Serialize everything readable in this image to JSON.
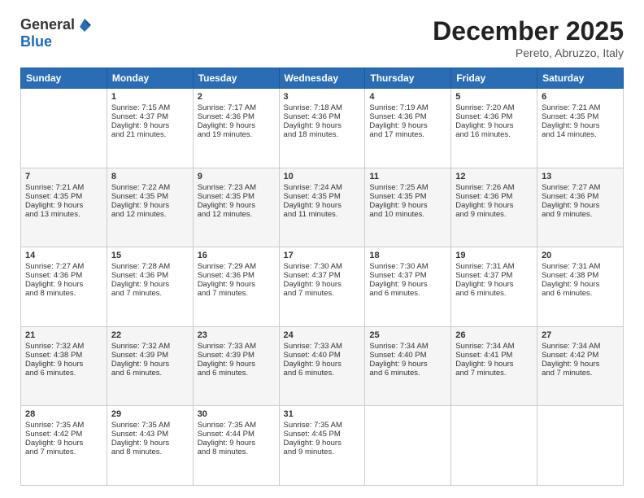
{
  "header": {
    "logo_general": "General",
    "logo_blue": "Blue",
    "month_title": "December 2025",
    "location": "Pereto, Abruzzo, Italy"
  },
  "days_of_week": [
    "Sunday",
    "Monday",
    "Tuesday",
    "Wednesday",
    "Thursday",
    "Friday",
    "Saturday"
  ],
  "weeks": [
    [
      {
        "day": "",
        "info": ""
      },
      {
        "day": "1",
        "info": "Sunrise: 7:15 AM\nSunset: 4:37 PM\nDaylight: 9 hours\nand 21 minutes."
      },
      {
        "day": "2",
        "info": "Sunrise: 7:17 AM\nSunset: 4:36 PM\nDaylight: 9 hours\nand 19 minutes."
      },
      {
        "day": "3",
        "info": "Sunrise: 7:18 AM\nSunset: 4:36 PM\nDaylight: 9 hours\nand 18 minutes."
      },
      {
        "day": "4",
        "info": "Sunrise: 7:19 AM\nSunset: 4:36 PM\nDaylight: 9 hours\nand 17 minutes."
      },
      {
        "day": "5",
        "info": "Sunrise: 7:20 AM\nSunset: 4:36 PM\nDaylight: 9 hours\nand 16 minutes."
      },
      {
        "day": "6",
        "info": "Sunrise: 7:21 AM\nSunset: 4:35 PM\nDaylight: 9 hours\nand 14 minutes."
      }
    ],
    [
      {
        "day": "7",
        "info": "Sunrise: 7:21 AM\nSunset: 4:35 PM\nDaylight: 9 hours\nand 13 minutes."
      },
      {
        "day": "8",
        "info": "Sunrise: 7:22 AM\nSunset: 4:35 PM\nDaylight: 9 hours\nand 12 minutes."
      },
      {
        "day": "9",
        "info": "Sunrise: 7:23 AM\nSunset: 4:35 PM\nDaylight: 9 hours\nand 12 minutes."
      },
      {
        "day": "10",
        "info": "Sunrise: 7:24 AM\nSunset: 4:35 PM\nDaylight: 9 hours\nand 11 minutes."
      },
      {
        "day": "11",
        "info": "Sunrise: 7:25 AM\nSunset: 4:35 PM\nDaylight: 9 hours\nand 10 minutes."
      },
      {
        "day": "12",
        "info": "Sunrise: 7:26 AM\nSunset: 4:36 PM\nDaylight: 9 hours\nand 9 minutes."
      },
      {
        "day": "13",
        "info": "Sunrise: 7:27 AM\nSunset: 4:36 PM\nDaylight: 9 hours\nand 9 minutes."
      }
    ],
    [
      {
        "day": "14",
        "info": "Sunrise: 7:27 AM\nSunset: 4:36 PM\nDaylight: 9 hours\nand 8 minutes."
      },
      {
        "day": "15",
        "info": "Sunrise: 7:28 AM\nSunset: 4:36 PM\nDaylight: 9 hours\nand 7 minutes."
      },
      {
        "day": "16",
        "info": "Sunrise: 7:29 AM\nSunset: 4:36 PM\nDaylight: 9 hours\nand 7 minutes."
      },
      {
        "day": "17",
        "info": "Sunrise: 7:30 AM\nSunset: 4:37 PM\nDaylight: 9 hours\nand 7 minutes."
      },
      {
        "day": "18",
        "info": "Sunrise: 7:30 AM\nSunset: 4:37 PM\nDaylight: 9 hours\nand 6 minutes."
      },
      {
        "day": "19",
        "info": "Sunrise: 7:31 AM\nSunset: 4:37 PM\nDaylight: 9 hours\nand 6 minutes."
      },
      {
        "day": "20",
        "info": "Sunrise: 7:31 AM\nSunset: 4:38 PM\nDaylight: 9 hours\nand 6 minutes."
      }
    ],
    [
      {
        "day": "21",
        "info": "Sunrise: 7:32 AM\nSunset: 4:38 PM\nDaylight: 9 hours\nand 6 minutes."
      },
      {
        "day": "22",
        "info": "Sunrise: 7:32 AM\nSunset: 4:39 PM\nDaylight: 9 hours\nand 6 minutes."
      },
      {
        "day": "23",
        "info": "Sunrise: 7:33 AM\nSunset: 4:39 PM\nDaylight: 9 hours\nand 6 minutes."
      },
      {
        "day": "24",
        "info": "Sunrise: 7:33 AM\nSunset: 4:40 PM\nDaylight: 9 hours\nand 6 minutes."
      },
      {
        "day": "25",
        "info": "Sunrise: 7:34 AM\nSunset: 4:40 PM\nDaylight: 9 hours\nand 6 minutes."
      },
      {
        "day": "26",
        "info": "Sunrise: 7:34 AM\nSunset: 4:41 PM\nDaylight: 9 hours\nand 7 minutes."
      },
      {
        "day": "27",
        "info": "Sunrise: 7:34 AM\nSunset: 4:42 PM\nDaylight: 9 hours\nand 7 minutes."
      }
    ],
    [
      {
        "day": "28",
        "info": "Sunrise: 7:35 AM\nSunset: 4:42 PM\nDaylight: 9 hours\nand 7 minutes."
      },
      {
        "day": "29",
        "info": "Sunrise: 7:35 AM\nSunset: 4:43 PM\nDaylight: 9 hours\nand 8 minutes."
      },
      {
        "day": "30",
        "info": "Sunrise: 7:35 AM\nSunset: 4:44 PM\nDaylight: 9 hours\nand 8 minutes."
      },
      {
        "day": "31",
        "info": "Sunrise: 7:35 AM\nSunset: 4:45 PM\nDaylight: 9 hours\nand 9 minutes."
      },
      {
        "day": "",
        "info": ""
      },
      {
        "day": "",
        "info": ""
      },
      {
        "day": "",
        "info": ""
      }
    ]
  ]
}
